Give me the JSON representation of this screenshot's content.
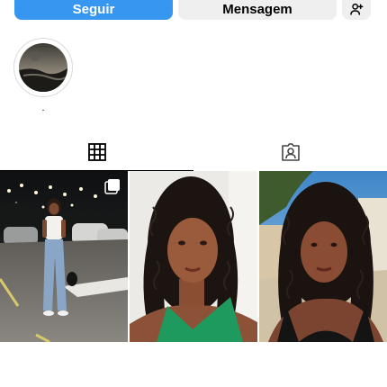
{
  "actions": {
    "follow_label": "Seguir",
    "message_label": "Mensagem",
    "add_person_icon": "add-person-icon"
  },
  "highlight": {
    "label": "."
  },
  "tabs": [
    {
      "icon": "grid-icon",
      "active": true
    },
    {
      "icon": "tagged-icon",
      "active": false
    }
  ],
  "posts": [
    {
      "description_icon": "multi-photo-icon"
    },
    {},
    {}
  ],
  "colors": {
    "accent": "#3797f0",
    "secondary_button": "#efefef"
  }
}
